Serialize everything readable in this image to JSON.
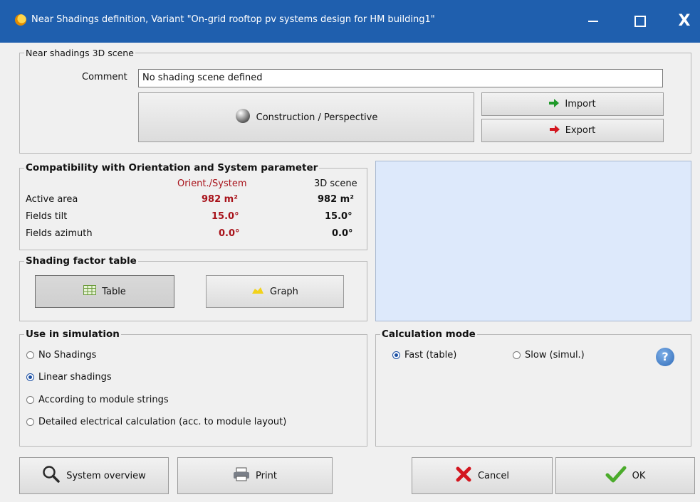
{
  "window": {
    "title": "Near Shadings definition, Variant \"On-grid rooftop pv systems design for HM building1\"",
    "minimize": "—",
    "maximize": "",
    "close": "X"
  },
  "scene": {
    "legend": "Near shadings 3D scene",
    "comment_label": "Comment",
    "comment_value": "No shading scene defined",
    "construction_label": "Construction / Perspective",
    "import_label": "Import",
    "export_label": "Export"
  },
  "compat": {
    "legend": "Compatibility with Orientation and System parameter",
    "col_orient": "Orient./System",
    "col_scene": "3D scene",
    "rows": [
      {
        "label": "Active area",
        "orient": "982 m²",
        "scene": "982 m²"
      },
      {
        "label": "Fields tilt",
        "orient": "15.0°",
        "scene": "15.0°"
      },
      {
        "label": "Fields azimuth",
        "orient": "0.0°",
        "scene": "0.0°"
      }
    ]
  },
  "shading_table": {
    "legend": "Shading factor table",
    "table_label": "Table",
    "graph_label": "Graph"
  },
  "simulation": {
    "legend": "Use in simulation",
    "options": [
      {
        "label": "No Shadings",
        "selected": false
      },
      {
        "label": "Linear shadings",
        "selected": true
      },
      {
        "label": "According to module strings",
        "selected": false
      },
      {
        "label": "Detailed electrical calculation (acc. to module layout)",
        "selected": false
      }
    ]
  },
  "calc_mode": {
    "legend": "Calculation mode",
    "fast_label": "Fast (table)",
    "slow_label": "Slow (simul.)",
    "selected": "fast",
    "help": "?"
  },
  "footer": {
    "overview_label": "System overview",
    "print_label": "Print",
    "cancel_label": "Cancel",
    "ok_label": "OK"
  },
  "colors": {
    "titlebar": "#1f5fae",
    "accent_red": "#a8121a",
    "preview_bg": "#dde9fb"
  },
  "icons": {
    "app": "app-sun-icon",
    "construction": "sphere-icon",
    "import": "green-arrow-icon",
    "export": "red-arrow-icon",
    "table": "table-grid-icon",
    "graph": "graph-icon",
    "overview": "magnifier-icon",
    "print": "printer-icon",
    "cancel": "red-x-icon",
    "ok": "green-check-icon",
    "help": "help-icon"
  }
}
